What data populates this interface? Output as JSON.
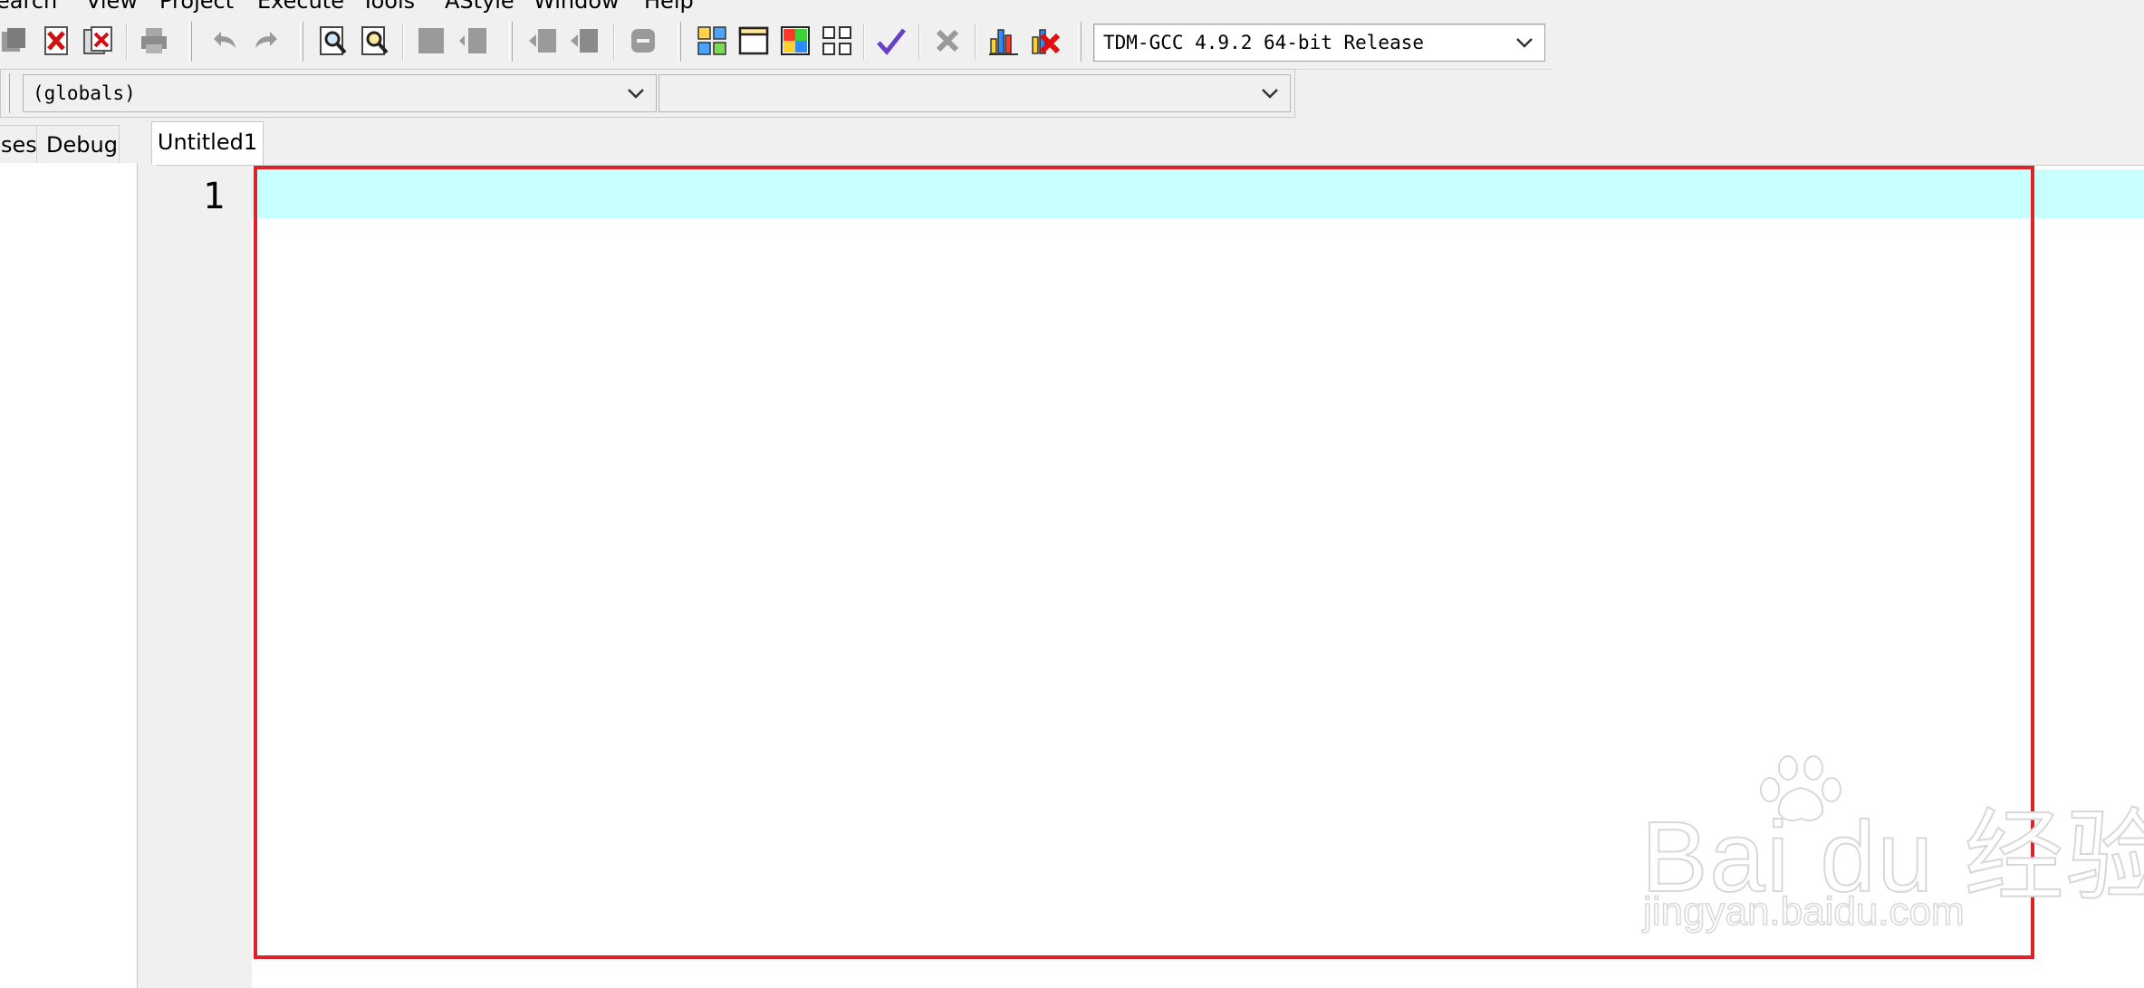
{
  "menu": {
    "items": [
      {
        "label": "earch"
      },
      {
        "label": "View"
      },
      {
        "label": "Project"
      },
      {
        "label": "Execute"
      },
      {
        "label": "Tools"
      },
      {
        "label": "AStyle"
      },
      {
        "label": "Window"
      },
      {
        "label": "Help"
      }
    ]
  },
  "toolbar": {
    "compiler_select": "TDM-GCC 4.9.2 64-bit Release",
    "icons": {
      "close_all": "close-all-icon",
      "close": "close-file-icon",
      "print": "print-icon",
      "undo": "undo-icon",
      "redo": "redo-icon",
      "find": "find-icon",
      "replace": "replace-icon",
      "indent": "indent-icon",
      "unindent": "unindent-icon",
      "toggle_comment": "toggle-comment-icon",
      "new_class": "new-class-icon",
      "window": "window-icon",
      "color": "color-icon",
      "options": "options-icon",
      "check_syntax": "check-syntax-icon",
      "abort": "abort-icon",
      "profile": "profile-icon",
      "delete_profile": "delete-profile-icon"
    }
  },
  "toolbar2": {
    "scope_select": "(globals)",
    "function_select": ""
  },
  "left_panel": {
    "tabs": [
      {
        "label": "ses"
      },
      {
        "label": "Debug"
      }
    ]
  },
  "editor": {
    "tab_label": "Untitled1",
    "line_numbers": [
      "1"
    ],
    "code": "",
    "active_line_color": "#c8ffff",
    "highlight_color": "#e02228"
  },
  "watermark": {
    "logo_text": "Bai du 经验",
    "url": "jingyan.baidu.com"
  }
}
